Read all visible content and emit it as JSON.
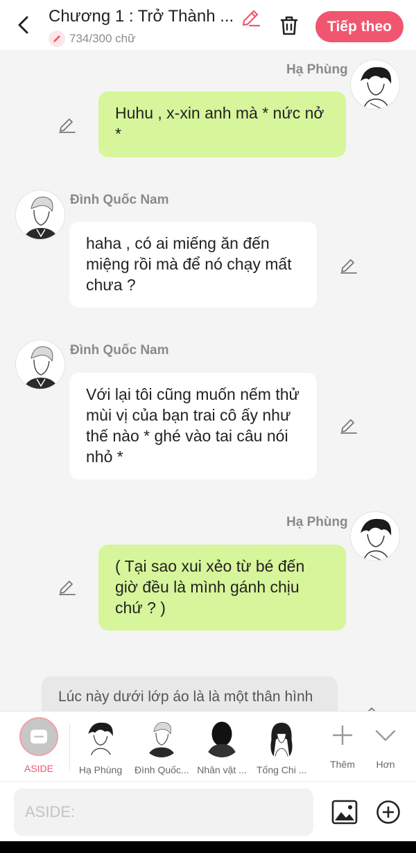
{
  "header": {
    "title": "Chương 1 : Trở Thành ...",
    "word_count": "734/300 chữ",
    "next_label": "Tiếp theo"
  },
  "messages": [
    {
      "speaker": "Hạ Phùng",
      "side": "right",
      "text": "Huhu , x-xin anh mà * nức nở *"
    },
    {
      "speaker": "Đình Quốc Nam",
      "side": "left",
      "text": "haha , có ai miếng ăn đến miệng rồi mà để nó chạy mất chưa ?"
    },
    {
      "speaker": "Đình Quốc Nam",
      "side": "left",
      "text": "Với lại tôi cũng muốn nếm thử mùi vị của bạn trai cô ấy như thế nào * ghé vào tai câu nói nhỏ *"
    },
    {
      "speaker": "Hạ Phùng",
      "side": "right",
      "text": "( Tại sao xui xẻo từ bé đến giờ đều là mình gánh chịu chứ ? )"
    },
    {
      "speaker": "",
      "side": "aside",
      "text": "Lúc này dưới lớp áo là là một thân hình"
    }
  ],
  "characters": {
    "aside_label": "ASIDE",
    "items": [
      "Hạ Phùng",
      "Đình Quốc...",
      "Nhân vật ...",
      "Tống Chi ..."
    ],
    "add_label": "Thêm",
    "more_label": "Hơn"
  },
  "input": {
    "placeholder": "ASIDE:"
  },
  "colors": {
    "accent": "#f0566f",
    "bubble_right": "#d7f59a",
    "bubble_left": "#ffffff"
  }
}
